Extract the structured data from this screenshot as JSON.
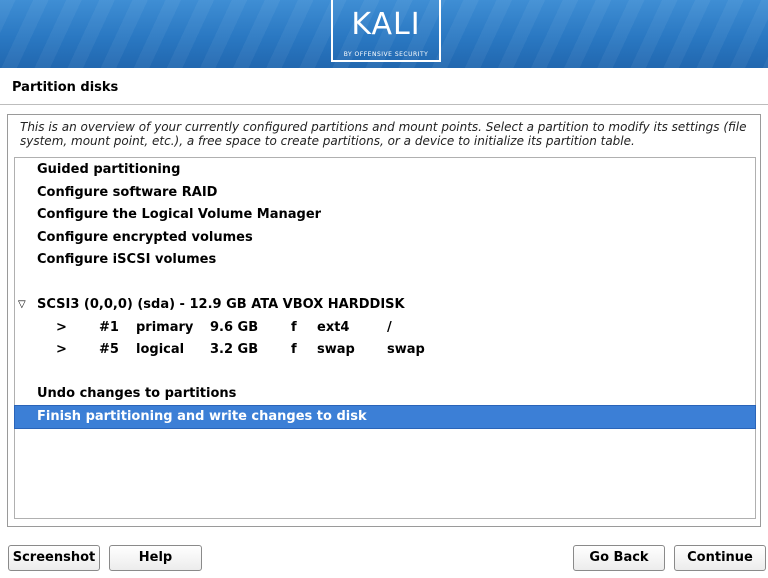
{
  "brand": {
    "logo_text": "KALI",
    "logo_subtext": "BY OFFENSIVE SECURITY",
    "colors": {
      "banner": "#2a78c2",
      "selection": "#3c7fd6"
    }
  },
  "page": {
    "title": "Partition disks",
    "description": "This is an overview of your currently configured partitions and mount points. Select a partition to modify its settings (file system, mount point, etc.), a free space to create partitions, or a device to initialize its partition table."
  },
  "menu": {
    "actions": [
      "Guided partitioning",
      "Configure software RAID",
      "Configure the Logical Volume Manager",
      "Configure encrypted volumes",
      "Configure iSCSI volumes"
    ],
    "disk": {
      "expand_icon": "▽",
      "label": "SCSI3 (0,0,0) (sda) - 12.9 GB ATA VBOX HARDDISK",
      "partitions": [
        {
          "arrow": ">",
          "number": "#1",
          "type": "primary",
          "size": "9.6 GB",
          "flag": "f",
          "fs": "ext4",
          "mount": "/"
        },
        {
          "arrow": ">",
          "number": "#5",
          "type": "logical",
          "size": "3.2 GB",
          "flag": "f",
          "fs": "swap",
          "mount": "swap"
        }
      ]
    },
    "undo": "Undo changes to partitions",
    "finish": "Finish partitioning and write changes to disk"
  },
  "buttons": {
    "screenshot": "Screenshot",
    "help": "Help",
    "go_back": "Go Back",
    "continue": "Continue"
  }
}
